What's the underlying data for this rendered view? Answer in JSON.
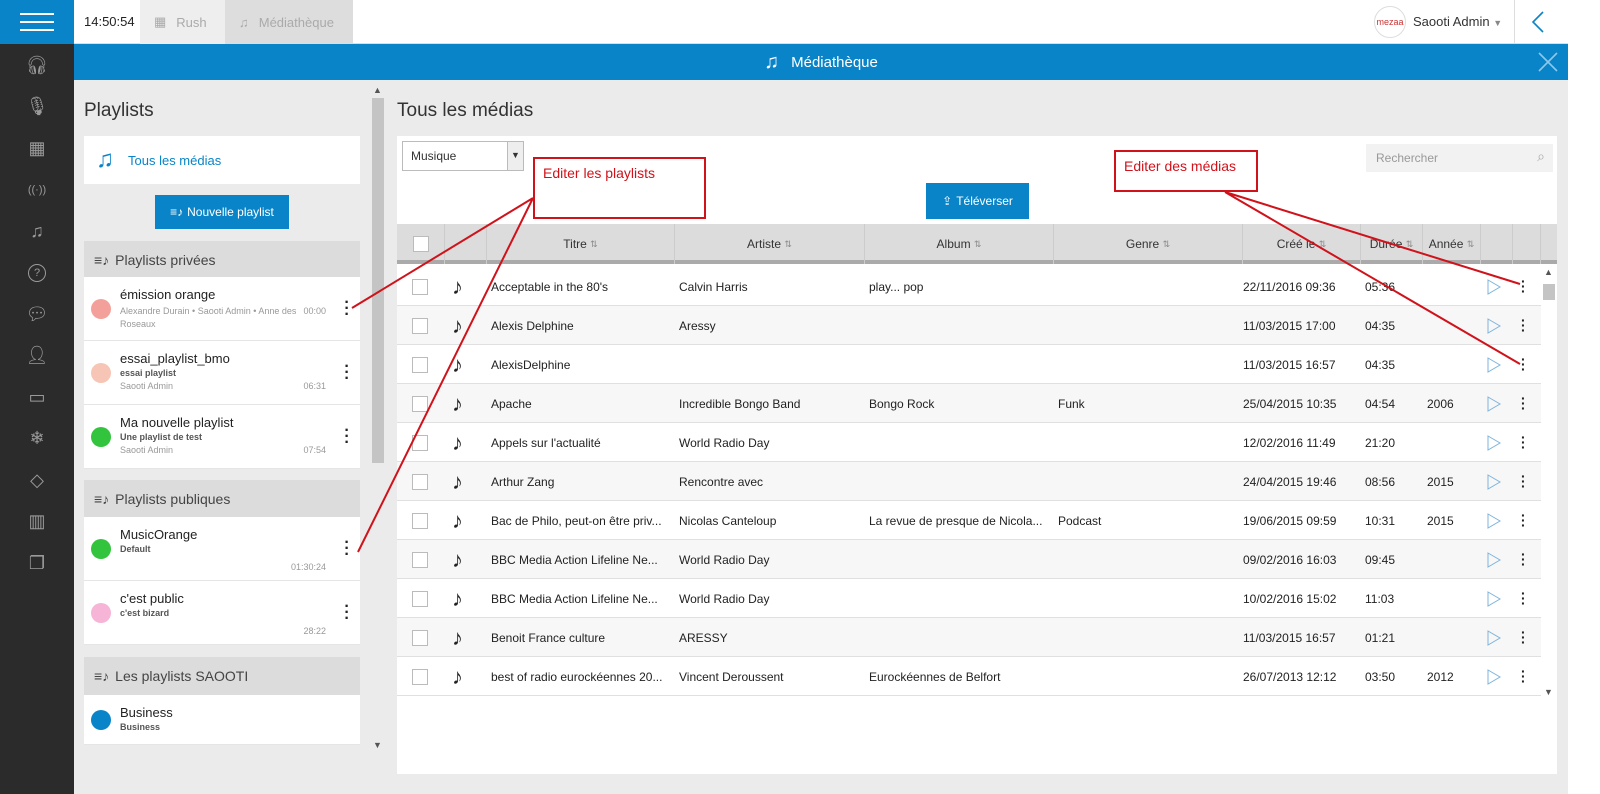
{
  "topbar": {
    "clock": "14:50:54",
    "tabs": [
      {
        "label": "Rush",
        "icon": "calendar-icon"
      },
      {
        "label": "Médiathèque",
        "icon": "music-note-icon"
      }
    ],
    "user": "Saooti Admin",
    "logo": "mezaa"
  },
  "sidebar": {
    "icons": [
      "headphones-icon",
      "microphone-icon",
      "calendar-icon",
      "broadcast-icon",
      "music-note-icon",
      "help-icon",
      "chat-icon",
      "user-icon",
      "video-icon",
      "snowflake-icon",
      "tag-icon",
      "bar-chart-icon",
      "copy-icon"
    ]
  },
  "header": {
    "title": "Médiathèque"
  },
  "playlists": {
    "title": "Playlists",
    "all_media": "Tous les médias",
    "new_button": "Nouvelle playlist",
    "sections": [
      {
        "title": "Playlists privées",
        "items": [
          {
            "name": "émission orange",
            "meta": "Alexandre Durain • Saooti Admin • Anne des Roseaux",
            "duration": "00:00",
            "color": "#f4a09a"
          },
          {
            "name": "essai_playlist_bmo",
            "subtitle": "essai playlist",
            "meta": "Saooti Admin",
            "duration": "06:31",
            "color": "#f7c5b5"
          },
          {
            "name": "Ma nouvelle playlist",
            "subtitle": "Une playlist de test",
            "meta": "Saooti Admin",
            "duration": "07:54",
            "color": "#33c43d"
          }
        ]
      },
      {
        "title": "Playlists publiques",
        "items": [
          {
            "name": "MusicOrange",
            "subtitle": "Default",
            "duration": "01:30:24",
            "color": "#33c43d"
          },
          {
            "name": "c'est public",
            "subtitle": "c'est bizard",
            "duration": "28:22",
            "color": "#f6b4d6"
          }
        ]
      },
      {
        "title": "Les playlists SAOOTI",
        "items": [
          {
            "name": "Business",
            "subtitle": "Business",
            "color": "#0a84c8"
          }
        ]
      }
    ]
  },
  "media": {
    "title": "Tous les médias",
    "filter": "Musique",
    "search_placeholder": "Rechercher",
    "upload_button": "Téléverser",
    "columns": [
      "Titre",
      "Artiste",
      "Album",
      "Genre",
      "Créé le",
      "Durée",
      "Année"
    ],
    "rows": [
      [
        "Acceptable in the 80's",
        "Calvin Harris",
        "play... pop",
        "",
        "22/11/2016 09:36",
        "05:36",
        ""
      ],
      [
        "Alexis Delphine",
        "Aressy",
        "",
        "",
        "11/03/2015 17:00",
        "04:35",
        ""
      ],
      [
        "AlexisDelphine",
        "",
        "",
        "",
        "11/03/2015 16:57",
        "04:35",
        ""
      ],
      [
        "Apache",
        "Incredible Bongo Band",
        "Bongo Rock",
        "Funk",
        "25/04/2015 10:35",
        "04:54",
        "2006"
      ],
      [
        "Appels sur l'actualité",
        "World Radio Day",
        "",
        "",
        "12/02/2016 11:49",
        "21:20",
        ""
      ],
      [
        "Arthur Zang",
        "Rencontre avec",
        "",
        "",
        "24/04/2015 19:46",
        "08:56",
        "2015"
      ],
      [
        "Bac de Philo, peut-on être priv...",
        "Nicolas Canteloup",
        "La revue de presque de Nicola...",
        "Podcast",
        "19/06/2015 09:59",
        "10:31",
        "2015"
      ],
      [
        "BBC Media Action Lifeline Ne...",
        "World Radio Day",
        "",
        "",
        "09/02/2016 16:03",
        "09:45",
        ""
      ],
      [
        "BBC Media Action Lifeline Ne...",
        "World Radio Day",
        "",
        "",
        "10/02/2016 15:02",
        "11:03",
        ""
      ],
      [
        "Benoit France culture",
        "ARESSY",
        "",
        "",
        "11/03/2015 16:57",
        "01:21",
        ""
      ],
      [
        "best of radio eurockéennes 20...",
        "Vincent Deroussent",
        "Eurockéennes de Belfort",
        "",
        "26/07/2013 12:12",
        "03:50",
        "2012"
      ]
    ]
  },
  "annotations": {
    "playlists": "Editer les playlists",
    "media": "Editer des médias"
  },
  "colors": {
    "accent": "#0a84c8",
    "annotation": "#d0121b",
    "sidebar": "#2b2b2b"
  }
}
